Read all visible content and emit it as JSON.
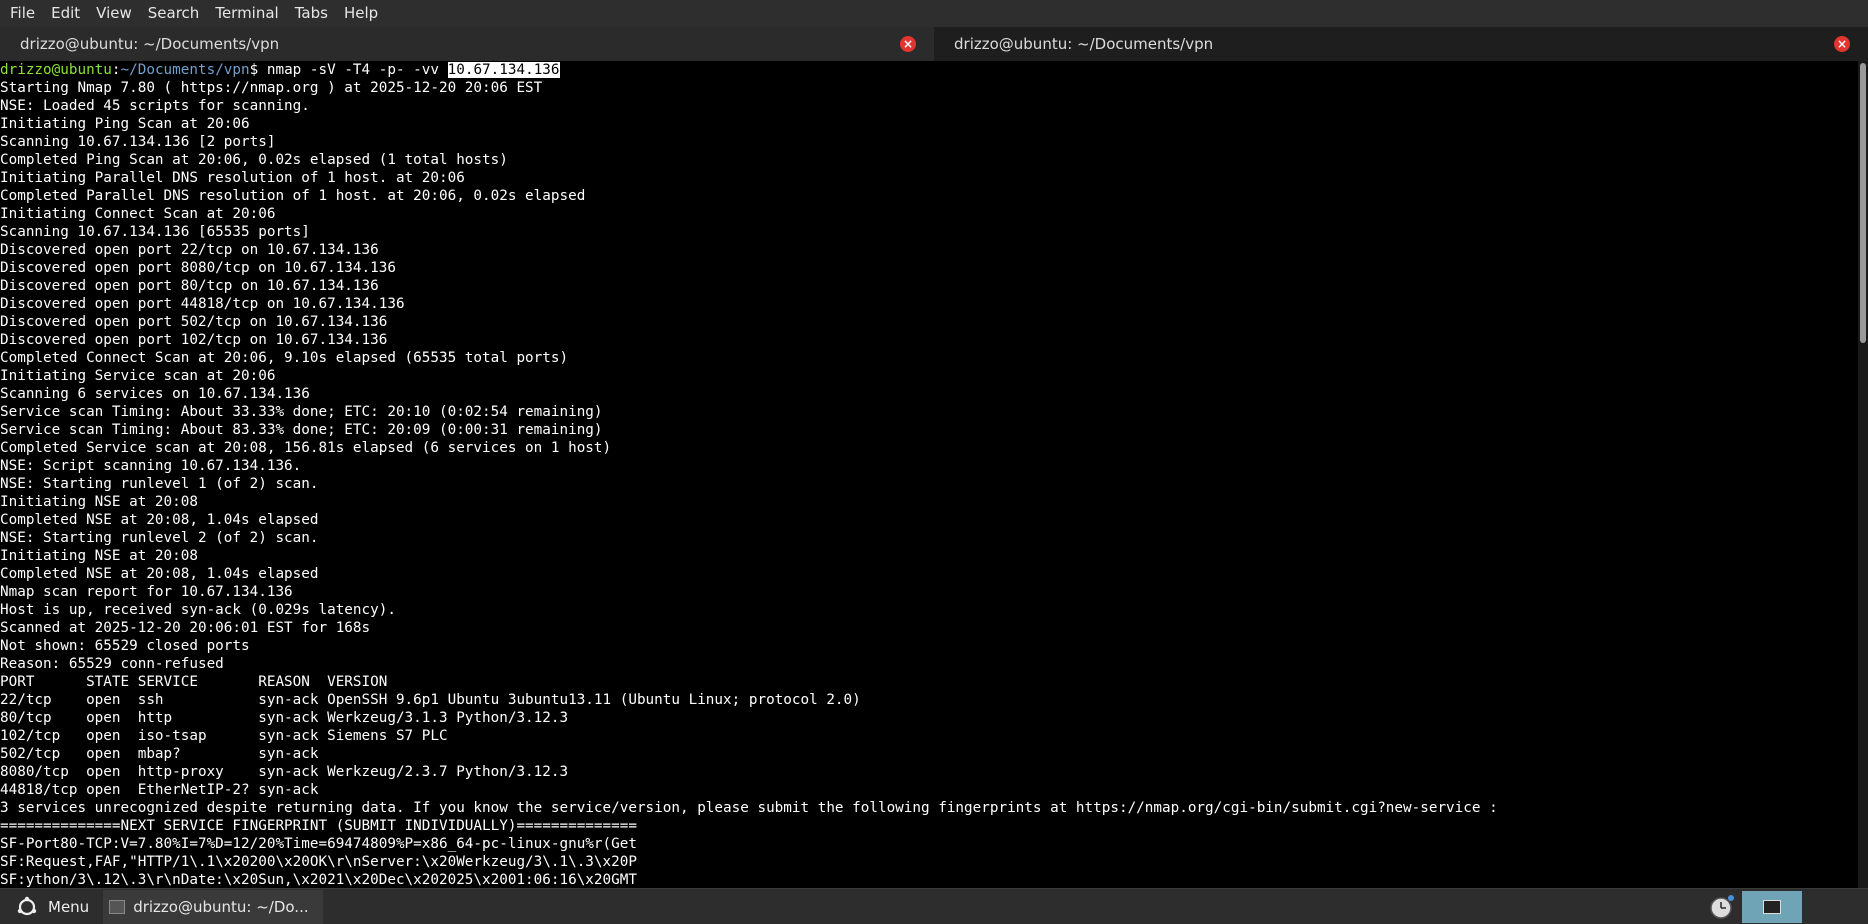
{
  "menubar": {
    "items": [
      "File",
      "Edit",
      "View",
      "Search",
      "Terminal",
      "Tabs",
      "Help"
    ]
  },
  "tabs": [
    {
      "title": "drizzo@ubuntu: ~/Documents/vpn",
      "active": false
    },
    {
      "title": "drizzo@ubuntu: ~/Documents/vpn",
      "active": true
    }
  ],
  "prompt": {
    "user_host": "drizzo@ubuntu",
    "separator": ":",
    "path": "~/Documents/vpn",
    "symbol": "$ ",
    "command": "nmap -sV -T4 -p- -vv ",
    "selected_arg": "10.67.134.136"
  },
  "output_lines": [
    "Starting Nmap 7.80 ( https://nmap.org ) at 2025-12-20 20:06 EST",
    "NSE: Loaded 45 scripts for scanning.",
    "Initiating Ping Scan at 20:06",
    "Scanning 10.67.134.136 [2 ports]",
    "Completed Ping Scan at 20:06, 0.02s elapsed (1 total hosts)",
    "Initiating Parallel DNS resolution of 1 host. at 20:06",
    "Completed Parallel DNS resolution of 1 host. at 20:06, 0.02s elapsed",
    "Initiating Connect Scan at 20:06",
    "Scanning 10.67.134.136 [65535 ports]",
    "Discovered open port 22/tcp on 10.67.134.136",
    "Discovered open port 8080/tcp on 10.67.134.136",
    "Discovered open port 80/tcp on 10.67.134.136",
    "Discovered open port 44818/tcp on 10.67.134.136",
    "Discovered open port 502/tcp on 10.67.134.136",
    "Discovered open port 102/tcp on 10.67.134.136",
    "Completed Connect Scan at 20:06, 9.10s elapsed (65535 total ports)",
    "Initiating Service scan at 20:06",
    "Scanning 6 services on 10.67.134.136",
    "Service scan Timing: About 33.33% done; ETC: 20:10 (0:02:54 remaining)",
    "Service scan Timing: About 83.33% done; ETC: 20:09 (0:00:31 remaining)",
    "Completed Service scan at 20:08, 156.81s elapsed (6 services on 1 host)",
    "NSE: Script scanning 10.67.134.136.",
    "NSE: Starting runlevel 1 (of 2) scan.",
    "Initiating NSE at 20:08",
    "Completed NSE at 20:08, 1.04s elapsed",
    "NSE: Starting runlevel 2 (of 2) scan.",
    "Initiating NSE at 20:08",
    "Completed NSE at 20:08, 1.04s elapsed",
    "Nmap scan report for 10.67.134.136",
    "Host is up, received syn-ack (0.029s latency).",
    "Scanned at 2025-12-20 20:06:01 EST for 168s",
    "Not shown: 65529 closed ports",
    "Reason: 65529 conn-refused",
    "PORT      STATE SERVICE       REASON  VERSION",
    "22/tcp    open  ssh           syn-ack OpenSSH 9.6p1 Ubuntu 3ubuntu13.11 (Ubuntu Linux; protocol 2.0)",
    "80/tcp    open  http          syn-ack Werkzeug/3.1.3 Python/3.12.3",
    "102/tcp   open  iso-tsap      syn-ack Siemens S7 PLC",
    "502/tcp   open  mbap?         syn-ack",
    "8080/tcp  open  http-proxy    syn-ack Werkzeug/2.3.7 Python/3.12.3",
    "44818/tcp open  EtherNetIP-2? syn-ack",
    "3 services unrecognized despite returning data. If you know the service/version, please submit the following fingerprints at https://nmap.org/cgi-bin/submit.cgi?new-service :",
    "==============NEXT SERVICE FINGERPRINT (SUBMIT INDIVIDUALLY)==============",
    "SF-Port80-TCP:V=7.80%I=7%D=12/20%Time=69474809%P=x86_64-pc-linux-gnu%r(Get",
    "SF:Request,FAF,\"HTTP/1\\.1\\x20200\\x20OK\\r\\nServer:\\x20Werkzeug/3\\.1\\.3\\x20P",
    "SF:ython/3\\.12\\.3\\r\\nDate:\\x20Sun,\\x2021\\x20Dec\\x202025\\x2001:06:16\\x20GMT"
  ],
  "taskbar": {
    "menu_label": "Menu",
    "window_label": "drizzo@ubuntu: ~/Do..."
  },
  "colors": {
    "prompt_user": "#8ae234",
    "prompt_path": "#729fcf",
    "tab_close": "#e3342f",
    "tray_terminal": "#6fa3b6"
  },
  "icons": {
    "tab_close": "close-icon",
    "menu": "mint-menu-icon",
    "tray_clock": "clock-icon",
    "tray_terminal": "terminal-icon"
  }
}
